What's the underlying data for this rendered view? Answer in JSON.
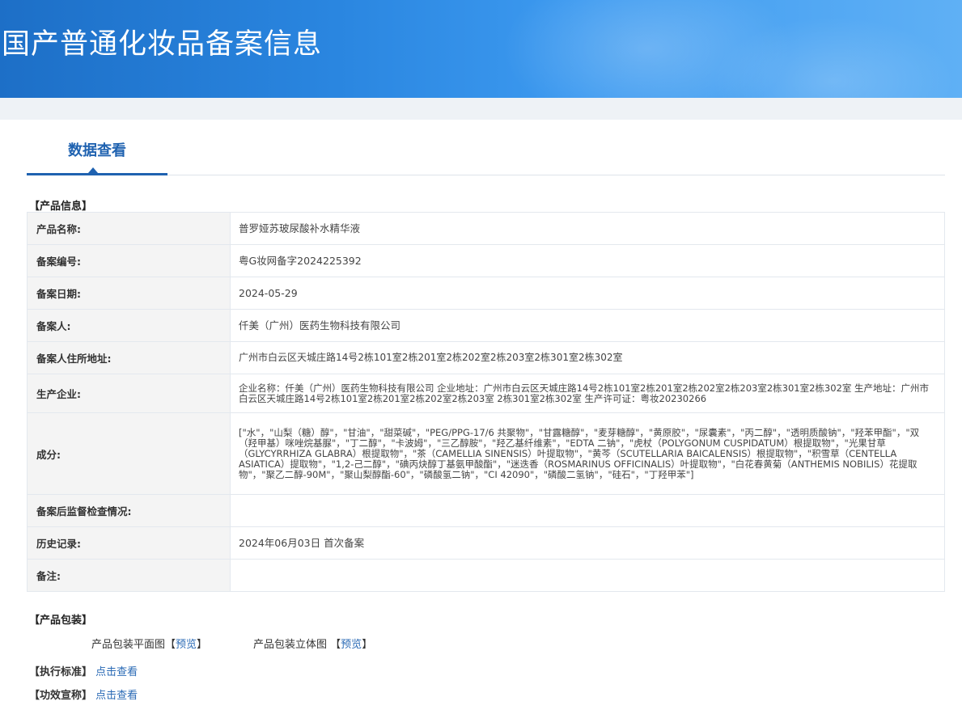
{
  "header": {
    "title": "国产普通化妆品备案信息"
  },
  "tabs": [
    {
      "label": "数据查看"
    }
  ],
  "product_info": {
    "section_title": "【产品信息】",
    "rows": [
      {
        "label": "产品名称:",
        "value": "普罗娅苏玻尿酸补水精华液"
      },
      {
        "label": "备案编号:",
        "value": "粤G妆网备字2024225392"
      },
      {
        "label": "备案日期:",
        "value": "2024-05-29"
      },
      {
        "label": "备案人:",
        "value": "仟美（广州）医药生物科技有限公司"
      },
      {
        "label": "备案人住所地址:",
        "value": "广州市白云区天城庄路14号2栋101室2栋201室2栋202室2栋203室2栋301室2栋302室"
      },
      {
        "label": "生产企业:",
        "value": "企业名称：仟美（广州）医药生物科技有限公司 企业地址：广州市白云区天城庄路14号2栋101室2栋201室2栋202室2栋203室2栋301室2栋302室 生产地址：广州市白云区天城庄路14号2栋101室2栋201室2栋202室2栋203室 2栋301室2栋302室 生产许可证：粤妆20230266"
      },
      {
        "label": "成分:",
        "value": "[\"水\"，\"山梨（糖）醇\"，\"甘油\"，\"甜菜碱\"，\"PEG/PPG-17/6 共聚物\"，\"甘露糖醇\"，\"麦芽糖醇\"，\"黄原胶\"，\"尿囊素\"，\"丙二醇\"，\"透明质酸钠\"，\"羟苯甲酯\"，\"双（羟甲基）咪唑烷基脲\"，\"丁二醇\"，\"卡波姆\"，\"三乙醇胺\"，\"羟乙基纤维素\"，\"EDTA 二钠\"，\"虎杖（POLYGONUM CUSPIDATUM）根提取物\"，\"光果甘草（GLYCYRRHIZA GLABRA）根提取物\"，\"茶（CAMELLIA SINENSIS）叶提取物\"，\"黄芩（SCUTELLARIA BAICALENSIS）根提取物\"，\"积雪草（CENTELLA ASIATICA）提取物\"，\"1,2-己二醇\"，\"碘丙炔醇丁基氨甲酸酯\"，\"迷迭香（ROSMARINUS OFFICINALIS）叶提取物\"，\"白花春黄菊（ANTHEMIS NOBILIS）花提取物\"，\"聚乙二醇-90M\"，\"聚山梨醇酯-60\"，\"磷酸氢二钠\"，\"CI 42090\"，\"磷酸二氢钠\"，\"硅石\"，\"丁羟甲苯\"]"
      },
      {
        "label": "备案后监督检查情况:",
        "value": ""
      },
      {
        "label": "历史记录:",
        "value": "2024年06月03日 首次备案"
      },
      {
        "label": "备注:",
        "value": ""
      }
    ]
  },
  "packaging": {
    "section_title": "【产品包装】",
    "flat_label": "产品包装平面图",
    "solid_label": "产品包装立体图",
    "bracket_open": "【",
    "bracket_close": "】",
    "preview": "预览"
  },
  "standard": {
    "label": "【执行标准】",
    "link": "点击查看"
  },
  "efficacy": {
    "label": "【功效宣称】",
    "link": "点击查看"
  }
}
